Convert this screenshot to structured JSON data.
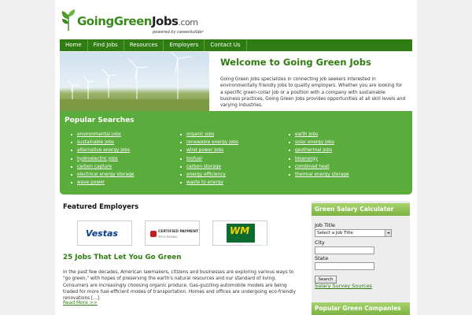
{
  "header": {
    "logo_going": "Going",
    "logo_green": "Green",
    "logo_jobs": "Jobs",
    "logo_com": ".com",
    "powered_by": "powered by careerbuilder"
  },
  "nav": {
    "items": [
      "Home",
      "Find Jobs",
      "Resources",
      "Employers",
      "Contact Us"
    ]
  },
  "hero": {
    "title": "Welcome to Going Green Jobs",
    "intro": "Going Green Jobs specializes in connecting job seekers interested in environmentally friendly jobs to quality employers. Whether you are looking for a specific green-collar job or a position with a company with sustainable business practices, Going Green Jobs provides opportunities at all skill levels and varying industries."
  },
  "popular": {
    "title": "Popular Searches",
    "col1": [
      "environmental jobs",
      "sustainable jobs",
      "alternative energy jobs",
      "hydroelectric jobs",
      "carbon capture",
      "electrical energy storage",
      "wave power"
    ],
    "col2": [
      "organic jobs",
      "renewable energy jobs",
      "wind power jobs",
      "biofuel",
      "carbon storage",
      "energy efficiency",
      "waste to energy"
    ],
    "col3": [
      "earth jobs",
      "solar energy jobs",
      "geothermal jobs",
      "bioenergy",
      "combined heat",
      "thermal energy storage"
    ]
  },
  "featured": {
    "title": "Featured Employers",
    "vestas": "Vestas",
    "cpp_line1": "CERTIFIED PAYMENT",
    "cpp_line2": "PROCESSING",
    "wm": "WM",
    "wm_sub": "WASTE MANAGEMENT"
  },
  "article": {
    "title": "25 Jobs That Let You Go Green",
    "body": "In the past few decades, American lawmakers, citizens and businesses are exploring various ways to \"go green,\" with hopes of preserving the earth's natural resources and our standard of living. Consumers are increasingly choosing organic produce. Gas-guzzling automobile models are being traded for more fuel-efficient modes of transportation. Homes and offices are undergoing eco-friendly renovations [...]",
    "read_more": "Read More >>"
  },
  "salary": {
    "title": "Green Salary Calculator",
    "job_title_label": "Job Title",
    "job_title_value": "Select a Job Title",
    "city_label": "City",
    "state_label": "State",
    "search_button": "Search",
    "survey_link": "Salary Survey Sources"
  },
  "companies": {
    "title": "Popular Green Companies"
  },
  "colors": {
    "brand_green": "#2f7d12",
    "popular_bg": "#5aac3c",
    "sidebar_head": "#7cb342"
  }
}
